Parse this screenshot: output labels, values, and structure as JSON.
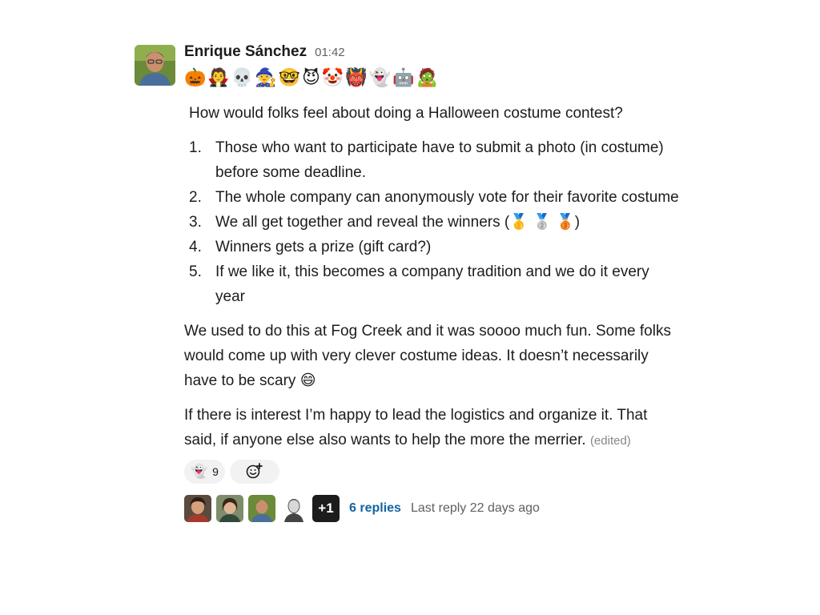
{
  "message": {
    "author": "Enrique Sánchez",
    "timestamp": "01:42",
    "status_emoji": "🎃🧛💀🧙🤓😈🤡👹👻🤖🧟",
    "intro": "How would folks feel about doing a Halloween costume contest?",
    "list": [
      {
        "num": "1.",
        "text": "Those who want to participate have to submit a photo (in costume) before some deadline."
      },
      {
        "num": "2.",
        "text": "The whole company can anonymously vote for their favorite costume"
      },
      {
        "num": "3.",
        "text_before": "We all get together and reveal the winners (",
        "medals": "🥇 🥈 🥉",
        "text_after": ")"
      },
      {
        "num": "4.",
        "text": "Winners gets a prize (gift card?)"
      },
      {
        "num": "5.",
        "text": "If we like it, this becomes a company tradition and we do it every year"
      }
    ],
    "paragraph1_text": "We used to do this at Fog Creek and it was soooo much fun. Some folks would come up with very clever costume ideas. It doesn’t necessarily have to be scary ",
    "paragraph1_emoji": "😄",
    "paragraph2_text": "If there is interest I’m happy to lead the logistics and organize it. That said, if anyone else also wants to help the more the merrier.",
    "edited_label": "(edited)"
  },
  "reactions": [
    {
      "emoji": "👻",
      "count": "9"
    }
  ],
  "add_reaction_icon": "add-reaction-icon",
  "thread": {
    "extra_count": "+1",
    "replies_label": "6 replies",
    "last_reply": "Last reply 22 days ago"
  },
  "colors": {
    "link": "#1264a3",
    "muted": "#616061",
    "text": "#1d1c1d",
    "reaction_bg": "#f2f2f2"
  }
}
